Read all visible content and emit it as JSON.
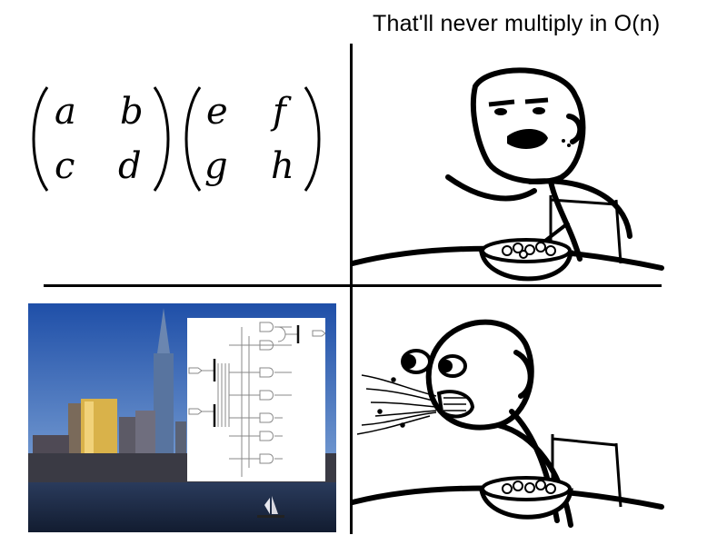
{
  "caption": {
    "text": "That'll never multiply in O(n)"
  },
  "matrix_a": {
    "r1c1": "a",
    "r1c2": "b",
    "r2c1": "c",
    "r2c2": "d"
  },
  "matrix_b": {
    "r1c1": "e",
    "r1c2": "f",
    "r2c1": "g",
    "r2c2": "h"
  },
  "colors": {
    "sky_top": "#1f4fa8",
    "sky_bottom": "#7fa4d6",
    "water": "#1b2a44",
    "building_lit": "#e8c65a"
  }
}
